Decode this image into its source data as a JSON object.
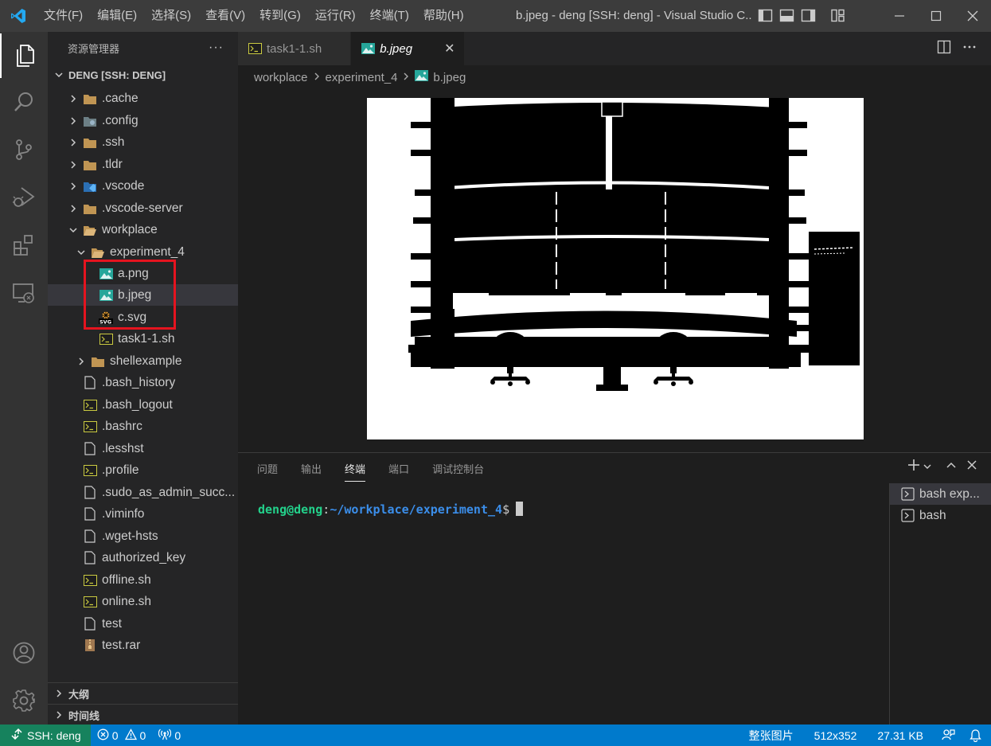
{
  "window": {
    "title": "b.jpeg - deng [SSH: deng] - Visual Studio C...",
    "menu": [
      "文件(F)",
      "编辑(E)",
      "选择(S)",
      "查看(V)",
      "转到(G)",
      "运行(R)",
      "终端(T)",
      "帮助(H)"
    ]
  },
  "sidebar": {
    "title": "资源管理器",
    "more": "···",
    "root": "DENG [SSH: DENG]",
    "items": [
      {
        "label": ".cache"
      },
      {
        "label": ".config"
      },
      {
        "label": ".ssh"
      },
      {
        "label": ".tldr"
      },
      {
        "label": ".vscode"
      },
      {
        "label": ".vscode-server"
      },
      {
        "label": "workplace"
      },
      {
        "label": "experiment_4"
      },
      {
        "label": "a.png"
      },
      {
        "label": "b.jpeg"
      },
      {
        "label": "c.svg"
      },
      {
        "label": "task1-1.sh"
      },
      {
        "label": "shellexample"
      },
      {
        "label": ".bash_history"
      },
      {
        "label": ".bash_logout"
      },
      {
        "label": ".bashrc"
      },
      {
        "label": ".lesshst"
      },
      {
        "label": ".profile"
      },
      {
        "label": ".sudo_as_admin_succ..."
      },
      {
        "label": ".viminfo"
      },
      {
        "label": ".wget-hsts"
      },
      {
        "label": "authorized_key"
      },
      {
        "label": "offline.sh"
      },
      {
        "label": "online.sh"
      },
      {
        "label": "test"
      },
      {
        "label": "test.rar"
      }
    ],
    "outline": "大纲",
    "timeline": "时间线"
  },
  "editor": {
    "tabs": [
      {
        "label": "task1-1.sh"
      },
      {
        "label": "b.jpeg",
        "close": "✕"
      }
    ],
    "breadcrumb": [
      "workplace",
      "experiment_4",
      "b.jpeg"
    ]
  },
  "panel": {
    "tabs": [
      "问题",
      "输出",
      "终端",
      "端口",
      "调试控制台"
    ],
    "terminal": {
      "user": "deng@deng",
      "colon": ":",
      "path": "~/workplace/experiment_4",
      "sign": "$"
    },
    "terminals": [
      "bash exp...",
      "bash"
    ]
  },
  "statusbar": {
    "remote": "SSH: deng",
    "errors": "0",
    "warnings": "0",
    "ports": "0",
    "zoom": "整张图片",
    "dimensions": "512x352",
    "size": "27.31 KB"
  },
  "colors": {
    "accent": "#007acc",
    "remote": "#16825d",
    "highlight": "#e5141f"
  }
}
